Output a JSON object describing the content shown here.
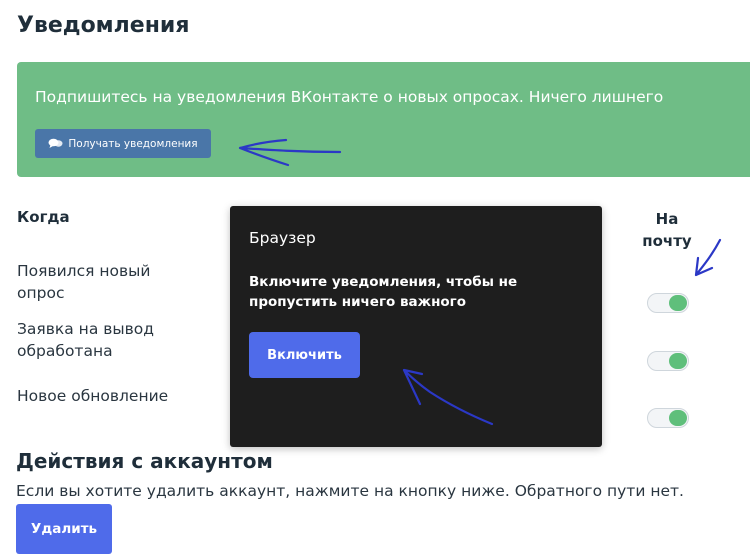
{
  "notifications": {
    "title": "Уведомления",
    "banner": {
      "text": "Подпишитесь на уведомления ВКонтакте о новых опросах. Ничего лишнего",
      "button_label": "Получать уведомления",
      "bg_color": "#6fbd86"
    },
    "columns": {
      "when": "Когда",
      "email": "На почту"
    },
    "rows": [
      {
        "label": "Появился новый опрос",
        "email_enabled": true
      },
      {
        "label": "Заявка на вывод обработана",
        "email_enabled": true
      },
      {
        "label": "Новое обновление",
        "email_enabled": true
      }
    ],
    "toggle_on_color": "#5fbf7b"
  },
  "browser_popup": {
    "title": "Браузер",
    "text": "Включите уведомления, чтобы не пропустить ничего важного",
    "button_label": "Включить",
    "bg_color": "#1e1e1e",
    "button_color": "#4f6bea"
  },
  "account": {
    "title": "Действия с аккаунтом",
    "text": "Если вы хотите удалить аккаунт, нажмите на кнопку ниже. Обратного пути нет.",
    "delete_label": "Удалить",
    "button_color": "#4f6bea"
  },
  "icons": {
    "vk_button": "chat-bubbles-icon"
  }
}
